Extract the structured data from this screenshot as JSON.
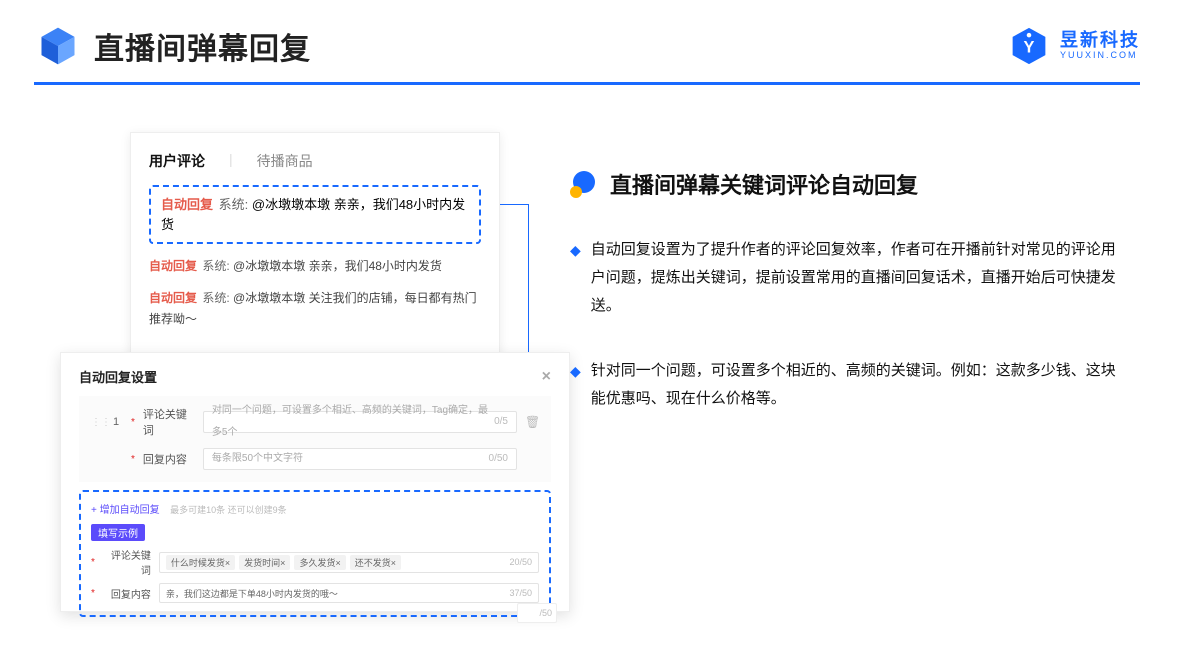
{
  "header": {
    "title": "直播间弹幕回复",
    "brand_cn": "昱新科技",
    "brand_en": "YUUXIN.COM"
  },
  "comments": {
    "tab_active": "用户评论",
    "tab_other": "待播商品",
    "highlighted": {
      "tag": "自动回复",
      "sys": "系统:",
      "text": "@冰墩墩本墩 亲亲，我们48小时内发货"
    },
    "items": [
      {
        "tag": "自动回复",
        "sys": "系统:",
        "text": "@冰墩墩本墩 亲亲，我们48小时内发货"
      },
      {
        "tag": "自动回复",
        "sys": "系统:",
        "text": "@冰墩墩本墩 关注我们的店铺，每日都有热门推荐呦～"
      }
    ]
  },
  "settings": {
    "title": "自动回复设置",
    "idx": "1",
    "kw_label": "评论关键词",
    "kw_placeholder": "对同一个问题，可设置多个相近、高频的关键词，Tag确定，最多5个",
    "kw_count": "0/5",
    "content_label": "回复内容",
    "content_placeholder": "每条限50个中文字符",
    "content_count": "0/50",
    "add_link": "+ 增加自动回复",
    "add_hint": "最多可建10条 还可以创建9条",
    "pill": "填写示例",
    "ex_kw_label": "评论关键词",
    "ex_chips": [
      "什么时候发货×",
      "发货时间×",
      "多久发货×",
      "还不发货×"
    ],
    "ex_kw_count": "20/50",
    "ex_content_label": "回复内容",
    "ex_content_value": "亲，我们这边都是下单48小时内发货的哦～",
    "ex_content_count": "37/50",
    "ghost_count": "/50"
  },
  "right": {
    "title": "直播间弹幕关键词评论自动回复",
    "p1": "自动回复设置为了提升作者的评论回复效率，作者可在开播前针对常见的评论用户问题，提炼出关键词，提前设置常用的直播间回复话术，直播开始后可快捷发送。",
    "p2": "针对同一个问题，可设置多个相近的、高频的关键词。例如：这款多少钱、这块能优惠吗、现在什么价格等。"
  }
}
